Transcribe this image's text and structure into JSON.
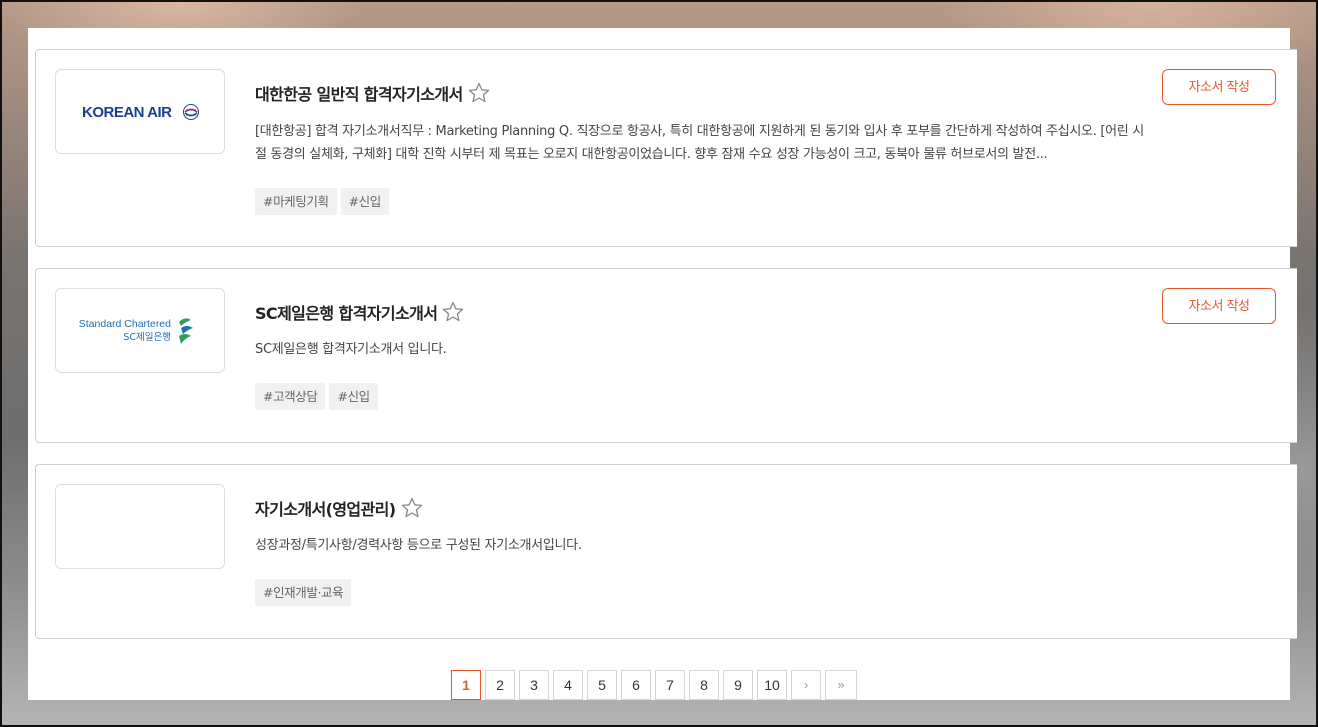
{
  "posts": [
    {
      "logo_text": "KOREAN AIR",
      "title": "대한한공 일반직 합격자기소개서",
      "description": "[대한항공] 합격 자기소개서직무 : Marketing Planning  Q. 직장으로 항공사, 특히 대한항공에 지원하게 된 동기와 입사 후 포부를 간단하게 작성하여 주십시오. [어린 시절 동경의 실체화, 구체화] 대학 진학 시부터 제 목표는 오로지 대한항공이었습니다. 향후 잠재 수요 성장 가능성이 크고, 동북아 물류 허브로서의 발전...",
      "tags": [
        "#마케팅기획",
        "#신입"
      ],
      "write_label": "자소서 작성"
    },
    {
      "logo_text_1": "Standard Chartered",
      "logo_text_2": "SC제일은행",
      "title": "SC제일은행 합격자기소개서",
      "description": "SC제일은행 합격자기소개서 입니다.",
      "tags": [
        "#고객상담",
        "#신입"
      ],
      "write_label": "자소서 작성"
    },
    {
      "title": "자기소개서(영업관리)",
      "description": "성장과정/특기사항/경력사항 등으로 구성된 자기소개서입니다.",
      "tags": [
        "#인재개발·교육"
      ]
    }
  ],
  "pagination": {
    "pages": [
      "1",
      "2",
      "3",
      "4",
      "5",
      "6",
      "7",
      "8",
      "9",
      "10"
    ],
    "current": "1",
    "next": "›",
    "last": "»"
  },
  "colors": {
    "accent": "#e8572c",
    "korean_air_blue": "#1b3f8f",
    "sc_blue": "#1f6fb2",
    "sc_green": "#2e9e5b"
  }
}
